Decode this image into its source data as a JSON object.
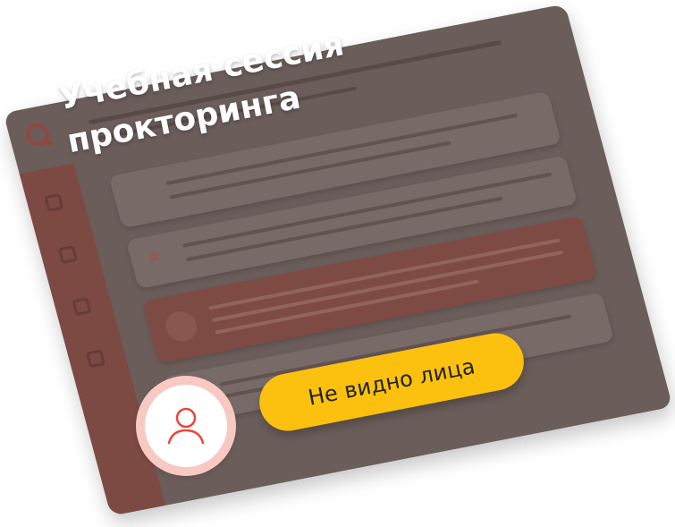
{
  "title": {
    "line1": "Учебная сессия",
    "line2": "прокторинга"
  },
  "alert": {
    "label": "Не видно лица"
  },
  "icons": {
    "avatar": "user-icon",
    "logo": "logo-icon"
  },
  "colors": {
    "card_background": "#6b5d5a",
    "sidebar": "#7c4a43",
    "alert_background": "#fcc10f",
    "avatar_ring": "#f8c9c2",
    "avatar_stroke": "#e8483a",
    "title_text": "#ffffff"
  }
}
